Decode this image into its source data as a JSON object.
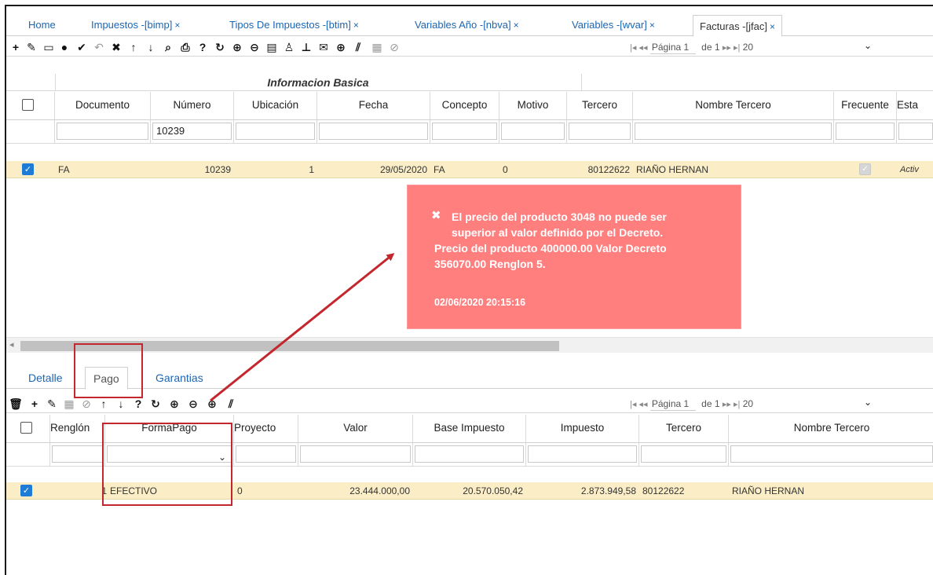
{
  "tabs": [
    {
      "label": "Home",
      "closable": false
    },
    {
      "label": "Impuestos -[bimp]",
      "closable": true
    },
    {
      "label": "Tipos De Impuestos -[btim]",
      "closable": true
    },
    {
      "label": "Variables Año -[nbva]",
      "closable": true
    },
    {
      "label": "Variables -[wvar]",
      "closable": true
    },
    {
      "label": "Facturas -[jfac]",
      "closable": true,
      "active": true
    }
  ],
  "close_glyph": "×",
  "main_toolbar": {
    "icons": [
      "add-icon",
      "edit-icon",
      "erase-icon",
      "save-icon",
      "check-icon",
      "undo-icon",
      "cancel-icon",
      "arrow-up-icon",
      "arrow-down-icon",
      "search-icon",
      "print-icon",
      "help-icon",
      "refresh-icon",
      "zoom-in-icon",
      "zoom-out-icon",
      "comment-icon",
      "user-icon",
      "pin-icon",
      "mail-icon",
      "plus-circle-icon",
      "slash-icon",
      "grid-icon",
      "block-icon"
    ],
    "pager": {
      "label": "Página 1",
      "of": "de 1",
      "count": "20"
    }
  },
  "main_grid": {
    "group_title": "Informacion Basica",
    "columns": [
      "Documento",
      "Número",
      "Ubicación",
      "Fecha",
      "Concepto",
      "Motivo",
      "Tercero",
      "Nombre Tercero",
      "Frecuente",
      "Esta"
    ],
    "filter_numero": "10239",
    "row": {
      "documento": "FA",
      "numero": "10239",
      "ubicacion": "1",
      "fecha": "29/05/2020",
      "concepto": "FA",
      "motivo": "0",
      "tercero": "80122622",
      "nombre_tercero": "RIAÑO HERNAN",
      "estado": "Activ"
    }
  },
  "error_popup": {
    "line1": "El precio del producto 3048 no puede ser",
    "line2": "superior al valor definido por el Decreto.",
    "line3": "Precio del producto 400000.00 Valor Decreto",
    "line4": "356070.00 Renglon 5.",
    "timestamp": "02/06/2020 20:15:16",
    "color": "#ff7f7f"
  },
  "sub_tabs": [
    "Detalle",
    "Pago",
    "Garantias"
  ],
  "sub_toolbar": {
    "icons": [
      "trash-icon",
      "add-icon",
      "edit-icon",
      "save-icon",
      "block-icon",
      "arrow-up-icon",
      "arrow-down-icon",
      "help-icon",
      "refresh-icon",
      "zoom-in-icon",
      "zoom-out-icon",
      "plus-circle-icon",
      "slash-icon"
    ],
    "pager": {
      "label": "Página 1",
      "of": "de 1",
      "count": "20"
    }
  },
  "pago_grid": {
    "columns": [
      "Renglón",
      "FormaPago",
      "Proyecto",
      "Valor",
      "Base Impuesto",
      "Impuesto",
      "Tercero",
      "Nombre Tercero"
    ],
    "row": {
      "renglon": "1",
      "forma_pago": "EFECTIVO",
      "proyecto": "0",
      "valor": "23.444.000,00",
      "base_impuesto": "20.570.050,42",
      "impuesto": "2.873.949,58",
      "tercero": "80122622",
      "nombre_tercero": "RIAÑO HERNAN"
    }
  },
  "colors": {
    "link": "#1b66b3",
    "row_highlight": "#fbeec7",
    "annotation_red": "#c4262e",
    "checkbox_blue": "#1e7bd6"
  }
}
